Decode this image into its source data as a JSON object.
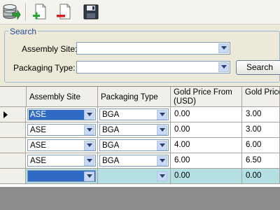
{
  "search": {
    "title": "Search",
    "assembly_label": "Assembly Site:",
    "assembly_value": "",
    "packaging_label": "Packaging Type:",
    "packaging_value": "",
    "button_label": "Search"
  },
  "grid": {
    "columns": [
      "Assembly Site",
      "Packaging Type",
      "Gold Price From (USD)",
      "Gold Price (USD)"
    ],
    "rows": [
      {
        "site": "ASE",
        "pkg": "BGA",
        "from": "0.00",
        "to": "3.00"
      },
      {
        "site": "ASE",
        "pkg": "BGA",
        "from": "0.00",
        "to": "3.00"
      },
      {
        "site": "ASE",
        "pkg": "BGA",
        "from": "4.00",
        "to": "6.00"
      },
      {
        "site": "ASE",
        "pkg": "BGA",
        "from": "6.00",
        "to": "6.50"
      }
    ],
    "new_row": {
      "site": "",
      "pkg": "",
      "from": "0.00",
      "to": "0.00"
    }
  },
  "toolbar": {
    "icons": [
      "database-icon",
      "new-document-icon",
      "delete-document-icon",
      "save-icon"
    ]
  },
  "colors": {
    "accent": "#1f4d9a",
    "new_row": "#b4e0e4",
    "selected": "#316ac5"
  }
}
